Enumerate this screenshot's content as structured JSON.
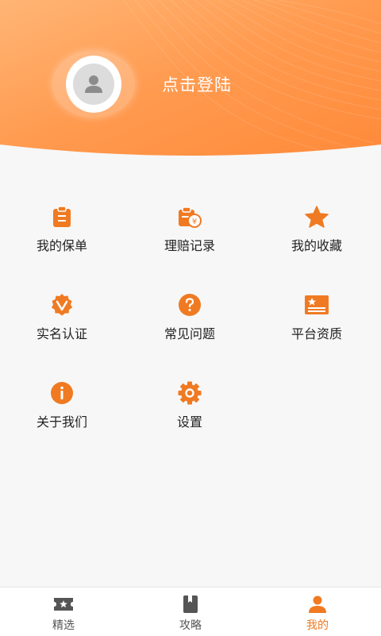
{
  "colors": {
    "accent": "#f07a22",
    "header_light": "#ffb06a",
    "header_dark": "#ff8a3a",
    "background": "#f7f7f7",
    "inactive_icon": "#555555"
  },
  "header": {
    "login_label": "点击登陆",
    "avatar_icon": "user-avatar-placeholder-icon"
  },
  "menu": {
    "items": [
      {
        "label": "我的保单",
        "icon": "clipboard-icon"
      },
      {
        "label": "理赔记录",
        "icon": "claim-receipt-yen-icon"
      },
      {
        "label": "我的收藏",
        "icon": "star-icon"
      },
      {
        "label": "实名认证",
        "icon": "verified-badge-icon"
      },
      {
        "label": "常见问题",
        "icon": "question-icon"
      },
      {
        "label": "平台资质",
        "icon": "certificate-icon"
      },
      {
        "label": "关于我们",
        "icon": "info-icon"
      },
      {
        "label": "设置",
        "icon": "gear-icon"
      }
    ]
  },
  "bottom_nav": {
    "items": [
      {
        "label": "精选",
        "icon": "ticket-star-icon",
        "active": false
      },
      {
        "label": "攻略",
        "icon": "book-icon",
        "active": false
      },
      {
        "label": "我的",
        "icon": "person-icon",
        "active": true
      }
    ]
  }
}
